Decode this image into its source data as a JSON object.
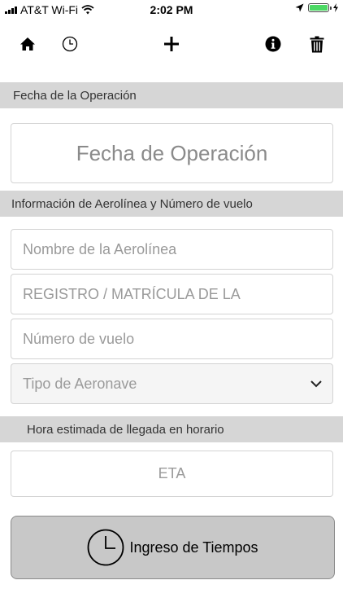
{
  "status_bar": {
    "carrier": "AT&T Wi-Fi",
    "time": "2:02 PM",
    "icons": [
      "signal-icon",
      "wifi-icon",
      "location-arrow-icon",
      "battery-icon"
    ]
  },
  "toolbar": {
    "icons": [
      "home-icon",
      "clock-icon",
      "plus-icon",
      "info-icon",
      "trash-icon"
    ]
  },
  "sections": {
    "operation_date": {
      "header": "Fecha de la Operación",
      "field_placeholder": "Fecha de Operación"
    },
    "airline_info": {
      "header": "Información de Aerolínea y Número de vuelo",
      "airline_placeholder": "Nombre de la Aerolínea",
      "registration_placeholder": "REGISTRO / MATRÍCULA DE LA",
      "flight_number_placeholder": "Número de vuelo",
      "aircraft_type_placeholder": "Tipo de Aeronave"
    },
    "eta": {
      "header": "Hora estimada de llegada en horario",
      "field_placeholder": "ETA"
    }
  },
  "main_button": {
    "label": "Ingreso de Tiempos",
    "icon": "clock-icon"
  },
  "colors": {
    "section_bg": "#d6d6d6",
    "button_bg": "#c8c8c8",
    "battery": "#4cd964",
    "placeholder": "#9a9a9a"
  }
}
